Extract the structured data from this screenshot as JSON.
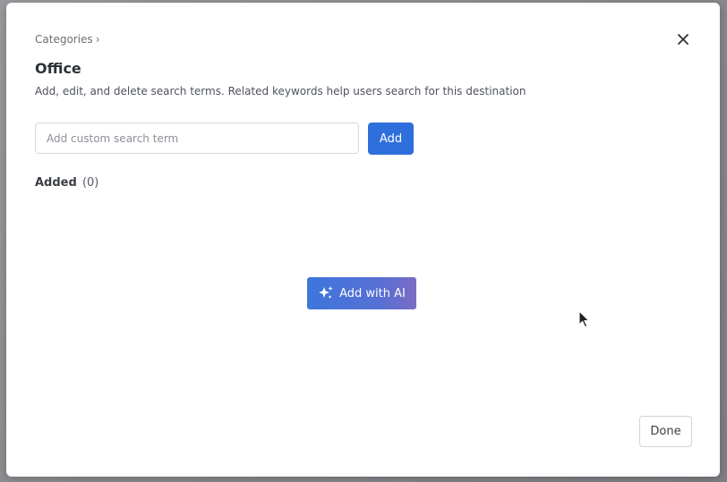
{
  "modal": {
    "breadcrumb": {
      "label": "Categories",
      "separator": "›"
    },
    "close_icon": "close-icon",
    "title": "Office",
    "description": "Add, edit, and delete search terms. Related keywords help users search for this destination",
    "search": {
      "placeholder": "Add custom search term",
      "value": ""
    },
    "add_label": "Add",
    "added": {
      "label": "Added",
      "count": "(0)"
    },
    "ai_button": {
      "label": "Add with AI",
      "icon": "sparkle-icon"
    },
    "done_label": "Done"
  },
  "colors": {
    "primary": "#2f6fdc",
    "ai_gradient_end": "#7b6cc4",
    "text_dark": "#2d3138",
    "text_muted": "#6b6f76"
  }
}
